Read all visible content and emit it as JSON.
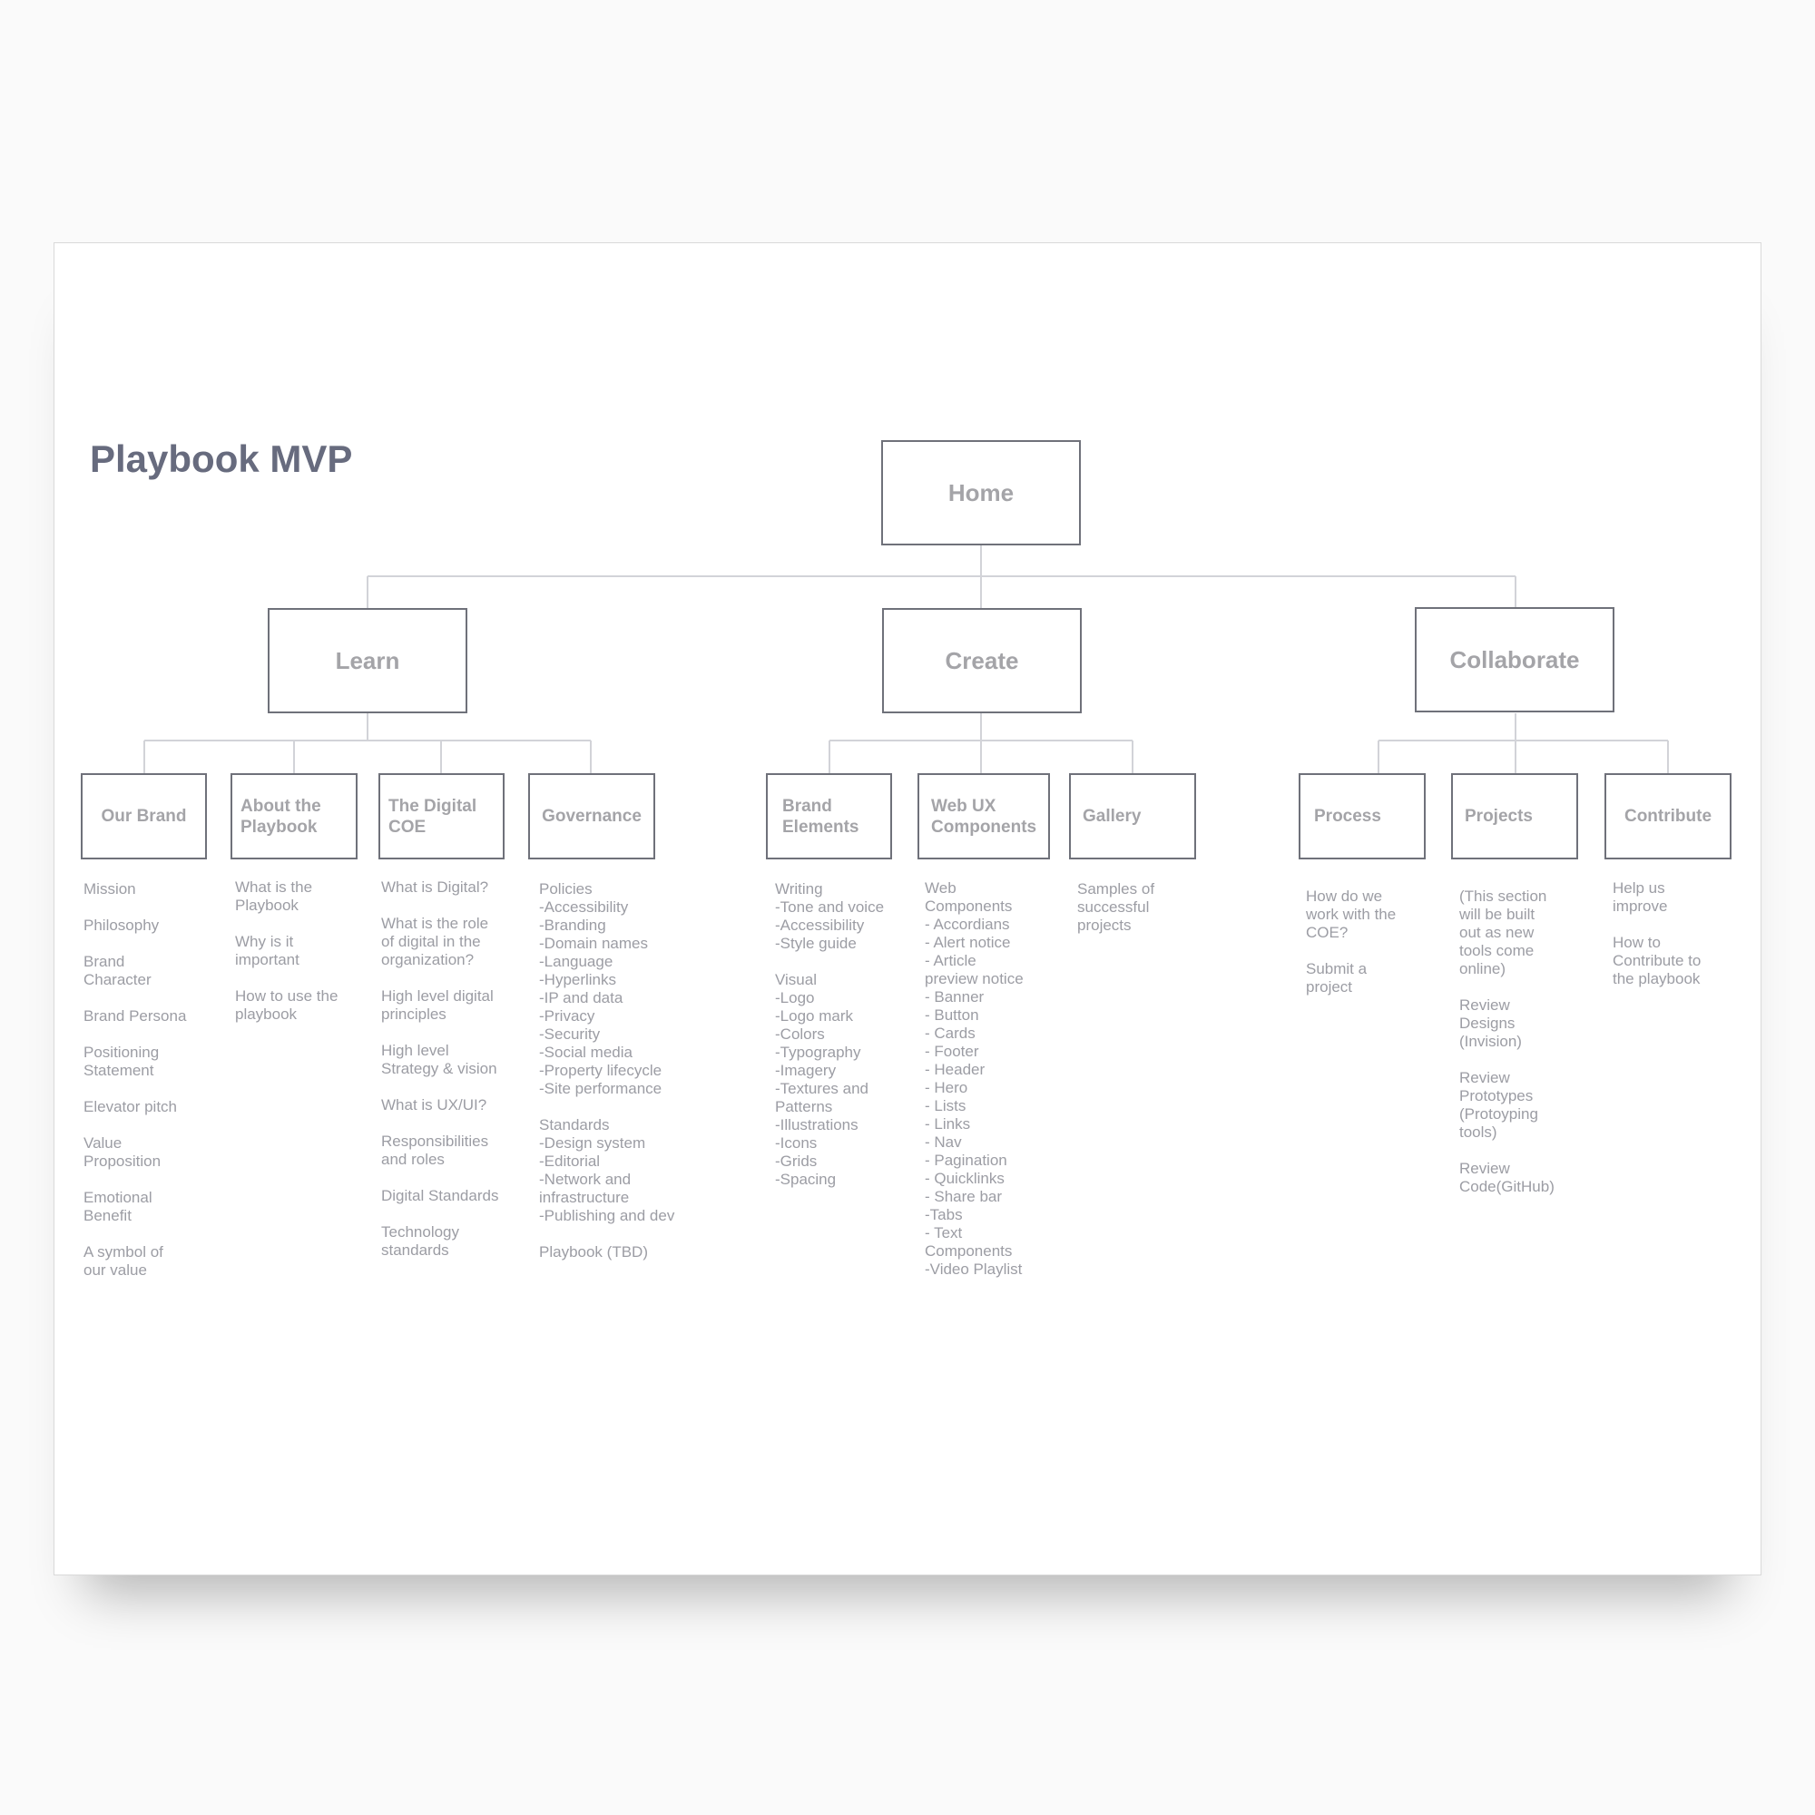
{
  "title": "Playbook MVP",
  "colors": {
    "box_border": "#6f717a",
    "connector": "#d2d3d8",
    "title": "#676b7e",
    "text": "#9c9da4"
  },
  "home": "Home",
  "sections": {
    "learn": {
      "label": "Learn",
      "topics": {
        "our_brand": {
          "label": "Our Brand",
          "items": [
            "Mission",
            "Philosophy",
            "Brand\nCharacter",
            "Brand Persona",
            "Positioning\nStatement",
            "Elevator pitch",
            "Value\nProposition",
            "Emotional\nBenefit",
            "A symbol of\nour value"
          ]
        },
        "about_playbook": {
          "label": "About the\nPlaybook",
          "items": [
            "What is the\nPlaybook",
            "Why is it\nimportant",
            "How to use the\nplaybook"
          ]
        },
        "digital_coe": {
          "label": "The Digital\nCOE",
          "items": [
            "What is Digital?",
            "What is the role\nof digital in the\norganization?",
            "High level digital\nprinciples",
            "High level\nStrategy & vision",
            "What is UX/UI?",
            "Responsibilities\nand roles",
            "Digital Standards",
            "Technology\nstandards"
          ]
        },
        "governance": {
          "label": "Governance",
          "items": [
            "Policies\n-Accessibility\n-Branding\n-Domain names\n-Language\n-Hyperlinks\n-IP and data\n-Privacy\n-Security\n-Social media\n-Property lifecycle\n-Site performance",
            "Standards\n-Design system\n-Editorial\n-Network and\ninfrastructure\n-Publishing and dev",
            "Playbook (TBD)"
          ]
        }
      }
    },
    "create": {
      "label": "Create",
      "topics": {
        "brand_elements": {
          "label": "Brand\nElements",
          "items": [
            "Writing\n-Tone and voice\n-Accessibility\n-Style guide",
            "Visual\n-Logo\n-Logo mark\n-Colors\n-Typography\n-Imagery\n-Textures and\nPatterns\n-Illustrations\n-Icons\n-Grids\n-Spacing"
          ]
        },
        "web_ux": {
          "label": "Web UX\nComponents",
          "items": [
            "Web\nComponents\n- Accordians\n- Alert notice\n- Article\npreview notice\n- Banner\n- Button\n- Cards\n- Footer\n- Header\n- Hero\n- Lists\n- Links\n- Nav\n- Pagination\n- Quicklinks\n- Share bar\n-Tabs\n- Text\nComponents\n-Video Playlist"
          ]
        },
        "gallery": {
          "label": "Gallery",
          "items": [
            "Samples of\nsuccessful\nprojects"
          ]
        }
      }
    },
    "collaborate": {
      "label": "Collaborate",
      "topics": {
        "process": {
          "label": "Process",
          "items": [
            "How do we\nwork with the\nCOE?",
            "Submit a\nproject"
          ]
        },
        "projects": {
          "label": "Projects",
          "items": [
            "(This section\nwill be built\nout as new\ntools come\nonline)",
            "Review\nDesigns\n(Invision)",
            "Review\nPrototypes\n(Protoyping\ntools)",
            "Review\nCode(GitHub)"
          ]
        },
        "contribute": {
          "label": "Contribute",
          "items": [
            "Help us\nimprove",
            "How to\nContribute to\nthe playbook"
          ]
        }
      }
    }
  }
}
